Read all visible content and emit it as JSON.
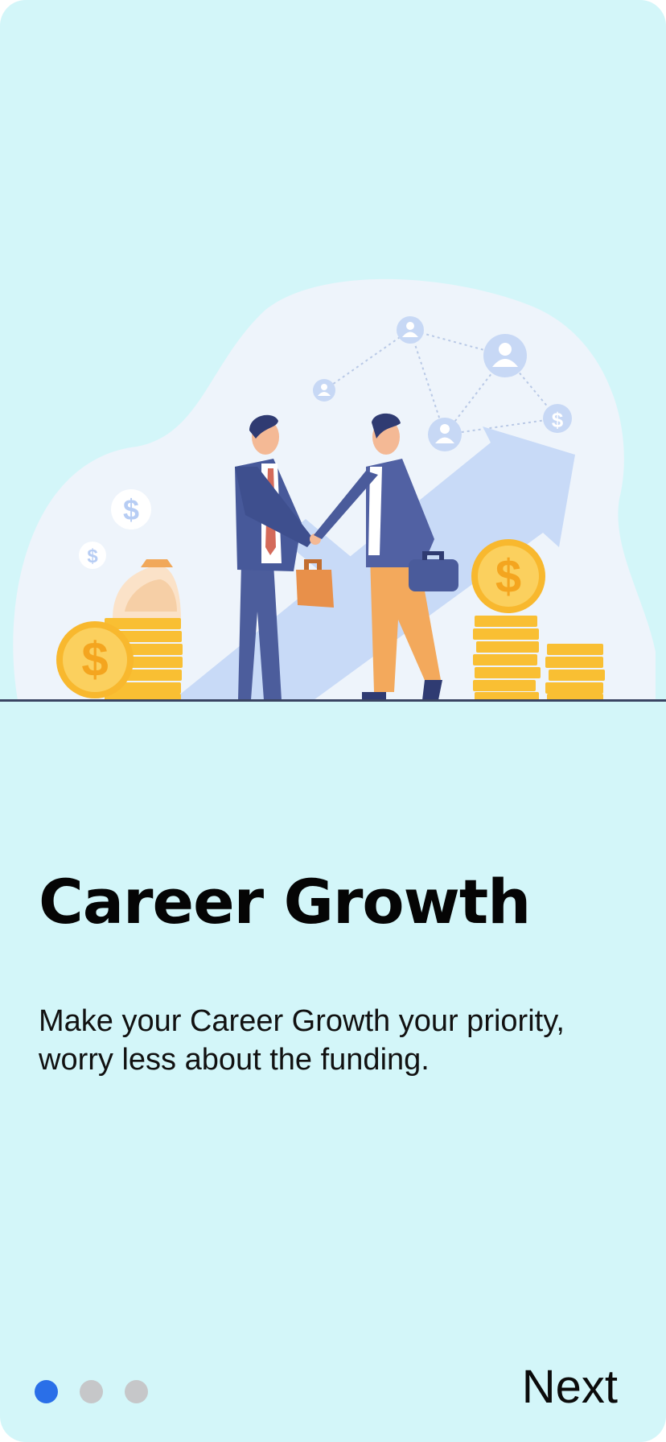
{
  "onboarding": {
    "title": "Career Growth",
    "description": "Make your Career Growth your priority, worry less about the funding.",
    "next_label": "Next",
    "pages": 3,
    "current_page": 1
  },
  "illustration": {
    "currency_symbol": "$"
  },
  "colors": {
    "background": "#d3f6f9",
    "accent": "#2a6fe8",
    "inactive_dot": "#c6c7c9",
    "text": "#050505"
  }
}
